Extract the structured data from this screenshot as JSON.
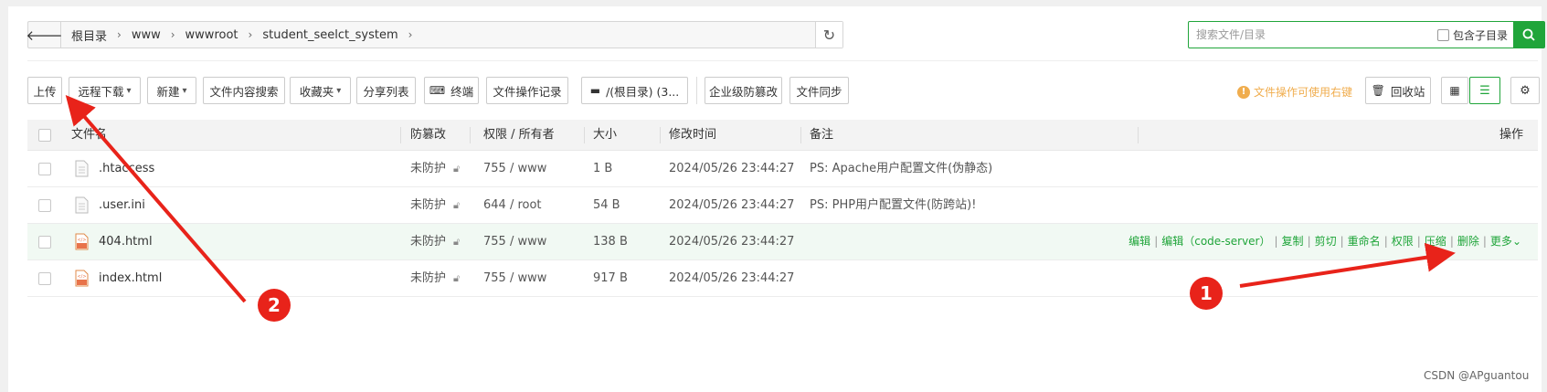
{
  "address_bar": {
    "breadcrumbs": [
      "根目录",
      "www",
      "wwwroot",
      "student_seelct_system"
    ]
  },
  "search": {
    "placeholder": "搜索文件/目录",
    "include_sub_label": "包含子目录"
  },
  "toolbar": {
    "upload": "上传",
    "remote_download": "远程下载",
    "new": "新建",
    "content_search": "文件内容搜索",
    "favorites": "收藏夹",
    "share_list": "分享列表",
    "terminal": "终端",
    "op_log": "文件操作记录",
    "disk": "/(根目录) (3...",
    "tamper_proof": "企业级防篡改",
    "file_sync": "文件同步",
    "tip": "文件操作可使用右键",
    "recycle_bin": "回收站"
  },
  "table": {
    "headers": {
      "name": "文件名",
      "tamper": "防篡改",
      "perm": "权限 / 所有者",
      "size": "大小",
      "mtime": "修改时间",
      "note": "备注",
      "ops": "操作"
    },
    "rows": [
      {
        "name": ".htaccess",
        "tamper": "未防护",
        "perm": "755 / www",
        "size": "1 B",
        "mtime": "2024/05/26 23:44:27",
        "note": "PS: Apache用户配置文件(伪静态)",
        "type": "text"
      },
      {
        "name": ".user.ini",
        "tamper": "未防护",
        "perm": "644 / root",
        "size": "54 B",
        "mtime": "2024/05/26 23:44:27",
        "note": "PS: PHP用户配置文件(防跨站)!",
        "type": "text"
      },
      {
        "name": "404.html",
        "tamper": "未防护",
        "perm": "755 / www",
        "size": "138 B",
        "mtime": "2024/05/26 23:44:27",
        "note": "",
        "type": "html"
      },
      {
        "name": "index.html",
        "tamper": "未防护",
        "perm": "755 / www",
        "size": "917 B",
        "mtime": "2024/05/26 23:44:27",
        "note": "",
        "type": "html"
      }
    ],
    "row_actions": {
      "edit": "编辑",
      "edit_code_server": "编辑（code-server）",
      "copy": "复制",
      "cut": "剪切",
      "rename": "重命名",
      "permission": "权限",
      "compress": "压缩",
      "delete": "删除",
      "more": "更多"
    }
  },
  "annotations": {
    "badge1": "1",
    "badge2": "2"
  },
  "watermark": "CSDN @APguantou",
  "colors": {
    "accent": "#20a53a",
    "warning": "#f0ad4e",
    "annotation": "#e8231a"
  }
}
